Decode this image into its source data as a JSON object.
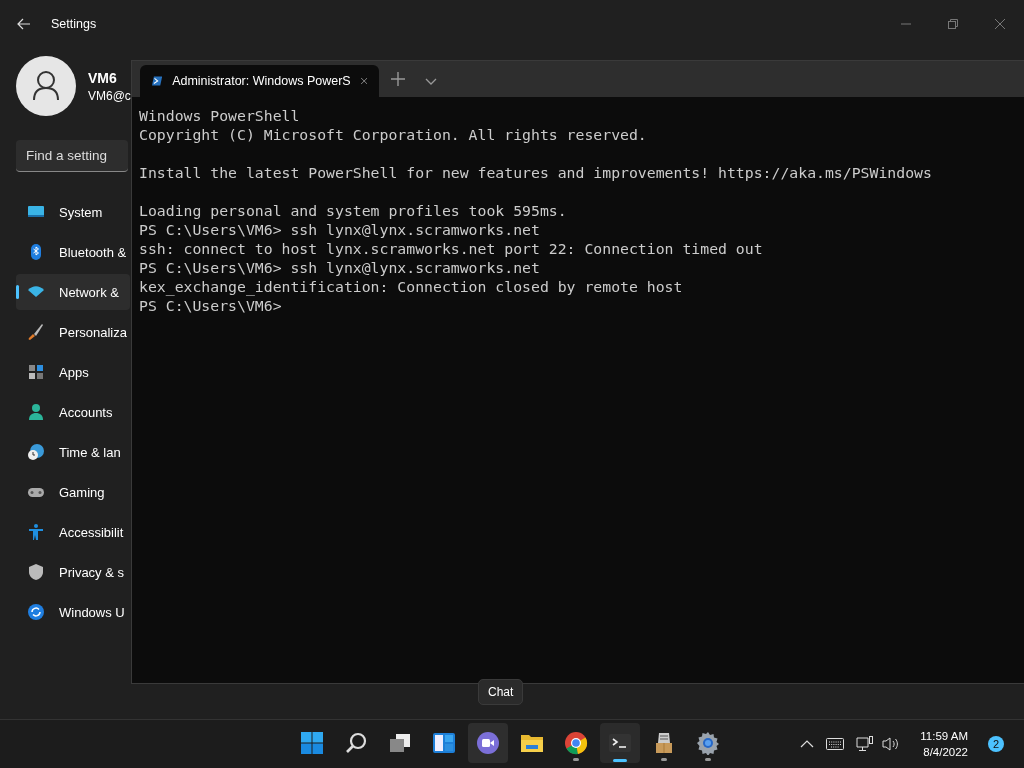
{
  "settings": {
    "title": "Settings",
    "user": {
      "name": "VM6",
      "email": "VM6@c"
    },
    "search": {
      "placeholder": "Find a setting"
    },
    "nav": [
      {
        "label": "System",
        "selected": false
      },
      {
        "label": "Bluetooth &",
        "selected": false
      },
      {
        "label": "Network &",
        "selected": true
      },
      {
        "label": "Personaliza",
        "selected": false
      },
      {
        "label": "Apps",
        "selected": false
      },
      {
        "label": "Accounts",
        "selected": false
      },
      {
        "label": "Time & lan",
        "selected": false
      },
      {
        "label": "Gaming",
        "selected": false
      },
      {
        "label": "Accessibilit",
        "selected": false
      },
      {
        "label": "Privacy & s",
        "selected": false
      },
      {
        "label": "Windows U",
        "selected": false
      }
    ]
  },
  "terminal": {
    "tab_title": "Administrator: Windows PowerS",
    "blocks": [
      [
        "Windows PowerShell",
        "Copyright (C) Microsoft Corporation. All rights reserved."
      ],
      [
        "Install the latest PowerShell for new features and improvements! https://aka.ms/PSWindows"
      ],
      [
        "Loading personal and system profiles took 595ms.",
        "PS C:\\Users\\VM6> ssh lynx@lynx.scramworks.net",
        "ssh: connect to host lynx.scramworks.net port 22: Connection timed out",
        "PS C:\\Users\\VM6> ssh lynx@lynx.scramworks.net",
        "kex_exchange_identification: Connection closed by remote host",
        "PS C:\\Users\\VM6>"
      ]
    ]
  },
  "tooltip": "Chat",
  "taskbar": {
    "apps": [
      {
        "active": false,
        "running": false,
        "hovered": false
      },
      {
        "active": false,
        "running": false,
        "hovered": false
      },
      {
        "active": false,
        "running": false,
        "hovered": false
      },
      {
        "active": false,
        "running": false,
        "hovered": false
      },
      {
        "active": false,
        "running": false,
        "hovered": true
      },
      {
        "active": false,
        "running": false,
        "hovered": false
      },
      {
        "active": false,
        "running": true,
        "hovered": false
      },
      {
        "active": true,
        "running": true,
        "hovered": false
      },
      {
        "active": false,
        "running": true,
        "hovered": false
      },
      {
        "active": false,
        "running": true,
        "hovered": false
      }
    ],
    "time": "11:59 AM",
    "date": "8/4/2022",
    "notifications": "2"
  }
}
